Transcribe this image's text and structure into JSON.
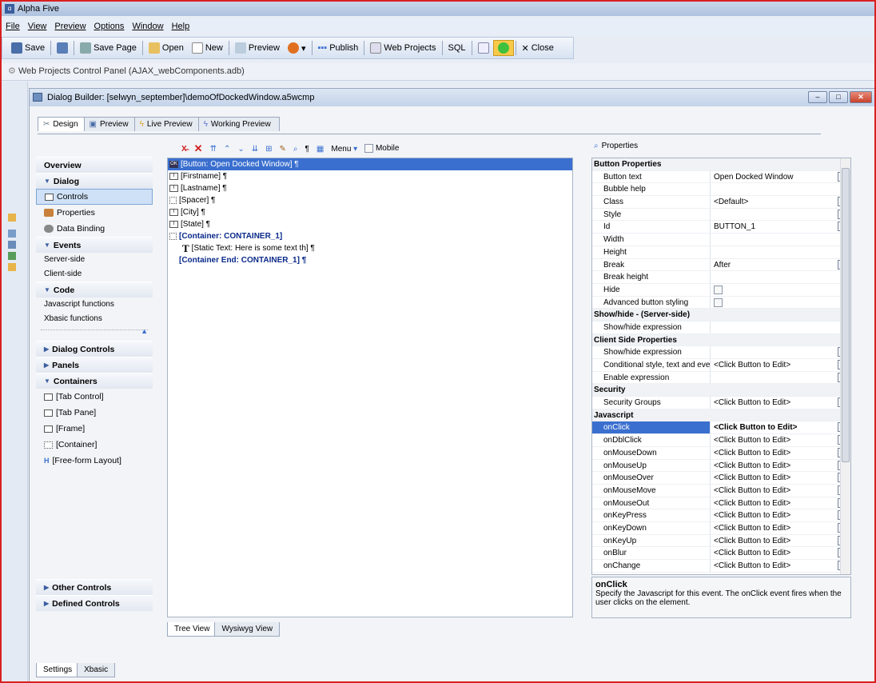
{
  "app": {
    "title": "Alpha Five"
  },
  "menu": [
    "File",
    "View",
    "Preview",
    "Options",
    "Window",
    "Help"
  ],
  "toolbar": {
    "save": "Save",
    "save_page": "Save Page",
    "open": "Open",
    "new": "New",
    "preview": "Preview",
    "publish": "Publish",
    "web_projects": "Web Projects",
    "sql": "SQL",
    "close": "Close"
  },
  "panel_title": "Web Projects Control Panel (AJAX_webComponents.adb)",
  "dialog": {
    "title": "Dialog Builder: [selwyn_september]\\demoOfDockedWindow.a5wcmp"
  },
  "tabs": [
    "Design",
    "Preview",
    "Live Preview",
    "Working Preview"
  ],
  "left_panel": {
    "overview": "Overview",
    "dialog": "Dialog",
    "controls": "Controls",
    "properties": "Properties",
    "data_binding": "Data Binding",
    "events": "Events",
    "server_side": "Server-side",
    "client_side": "Client-side",
    "code": "Code",
    "js_functions": "Javascript functions",
    "xbasic_functions": "Xbasic functions",
    "dialog_controls": "Dialog Controls",
    "panels": "Panels",
    "containers": "Containers",
    "tab_control": "[Tab Control]",
    "tab_pane": "[Tab Pane]",
    "frame": "[Frame]",
    "container": "[Container]",
    "freeform": "[Free-form Layout]",
    "other_controls": "Other Controls",
    "defined_controls": "Defined Controls"
  },
  "design_toolbar": {
    "menu": "Menu",
    "mobile": "Mobile"
  },
  "tree": [
    "[Button: Open Docked Window] ¶",
    "[Firstname] ¶",
    "[Lastname] ¶",
    "[Spacer] ¶",
    "[City] ¶",
    "[State] ¶",
    "[Container: CONTAINER_1]",
    "[Static Text: Here is some text th] ¶",
    "[Container End: CONTAINER_1] ¶"
  ],
  "bottom_tabs": [
    "Tree View",
    "Wysiwyg View"
  ],
  "settings_tabs": [
    "Settings",
    "Xbasic"
  ],
  "properties_label": "Properties",
  "props": [
    {
      "cat": "Button Properties"
    },
    {
      "n": "Button text",
      "v": "Open Docked Window",
      "btn": true
    },
    {
      "n": "Bubble help",
      "v": ""
    },
    {
      "n": "Class",
      "v": "<Default>",
      "btn": true
    },
    {
      "n": "Style",
      "v": "",
      "btn": true
    },
    {
      "n": "Id",
      "v": "BUTTON_1",
      "btn": true
    },
    {
      "n": "Width",
      "v": ""
    },
    {
      "n": "Height",
      "v": ""
    },
    {
      "n": "Break",
      "v": "After",
      "dd": true
    },
    {
      "n": "Break height",
      "v": ""
    },
    {
      "n": "Hide",
      "v": "",
      "chk": true
    },
    {
      "n": "Advanced button styling",
      "v": "",
      "chk": true
    },
    {
      "cat": "Show/hide - (Server-side)"
    },
    {
      "n": "Show/hide expression",
      "v": ""
    },
    {
      "cat": "Client Side Properties"
    },
    {
      "n": "Show/hide expression",
      "v": "",
      "btn": true
    },
    {
      "n": "Conditional style, text and events",
      "v": "<Click Button to Edit>",
      "btn": true
    },
    {
      "n": "Enable expression",
      "v": "",
      "btn": true
    },
    {
      "cat": "Security"
    },
    {
      "n": "Security Groups",
      "v": "<Click Button to Edit>",
      "btn": true
    },
    {
      "cat": "Javascript"
    },
    {
      "n": "onClick",
      "v": "<Click Button to Edit>",
      "btn": true,
      "sel": true
    },
    {
      "n": "onDblClick",
      "v": "<Click Button to Edit>",
      "btn": true
    },
    {
      "n": "onMouseDown",
      "v": "<Click Button to Edit>",
      "btn": true
    },
    {
      "n": "onMouseUp",
      "v": "<Click Button to Edit>",
      "btn": true
    },
    {
      "n": "onMouseOver",
      "v": "<Click Button to Edit>",
      "btn": true
    },
    {
      "n": "onMouseMove",
      "v": "<Click Button to Edit>",
      "btn": true
    },
    {
      "n": "onMouseOut",
      "v": "<Click Button to Edit>",
      "btn": true
    },
    {
      "n": "onKeyPress",
      "v": "<Click Button to Edit>",
      "btn": true
    },
    {
      "n": "onKeyDown",
      "v": "<Click Button to Edit>",
      "btn": true
    },
    {
      "n": "onKeyUp",
      "v": "<Click Button to Edit>",
      "btn": true
    },
    {
      "n": "onBlur",
      "v": "<Click Button to Edit>",
      "btn": true
    },
    {
      "n": "onChange",
      "v": "<Click Button to Edit>",
      "btn": true
    }
  ],
  "desc": {
    "title": "onClick",
    "text": "Specify the Javascript for this event. The onClick event fires when the user clicks on the element."
  }
}
